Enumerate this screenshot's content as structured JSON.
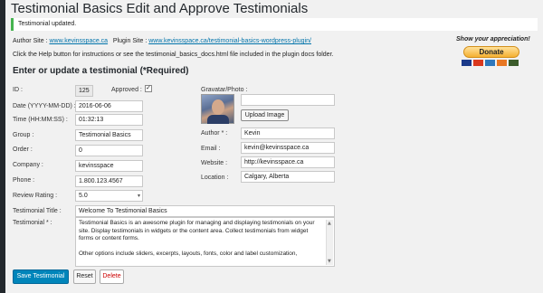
{
  "page": {
    "title": "Testimonial Basics Edit and Approve Testimonials",
    "notice": "Testimonial updated.",
    "author_site_label": "Author Site :",
    "author_site_link": "www.kevinsspace.ca",
    "plugin_site_label": "Plugin Site :",
    "plugin_site_link": "www.kevinsspace.ca/testimonial-basics-wordpress-plugin/",
    "help_text": "Click the Help button for instructions or see the testimonial_basics_docs.html file included in the plugin docs folder.",
    "appreciation": "Show your appreciation!",
    "donate_label": "Donate",
    "form_heading": "Enter or update a testimonial (*Required)"
  },
  "colors": {
    "accent": "#0073aa",
    "notice_border": "#46b450",
    "donate": "#f5b031",
    "delete": "#cc0000"
  },
  "form": {
    "id": {
      "label": "ID :",
      "value": "125"
    },
    "approved": {
      "label": "Approved :",
      "checked": true
    },
    "date": {
      "label": "Date (YYYY-MM-DD) :",
      "value": "2016-06-06"
    },
    "time": {
      "label": "Time (HH:MM:SS) :",
      "value": "01:32:13"
    },
    "group": {
      "label": "Group :",
      "value": "Testimonial Basics"
    },
    "order": {
      "label": "Order :",
      "value": "0"
    },
    "company": {
      "label": "Company :",
      "value": "kevinsspace"
    },
    "phone": {
      "label": "Phone :",
      "value": "1.800.123.4567"
    },
    "rating": {
      "label": "Review Rating :",
      "value": "5.0"
    },
    "testimonial_title": {
      "label": "Testimonial Title :",
      "value": "Welcome To Testimonial Basics"
    },
    "testimonial": {
      "label": "Testimonial * :",
      "para1": "Testimonial Basics is an awesome plugin for managing and displaying testimonials on your site. Display testimonials in widgets or the content area. Collect testimonials from widget forms or content forms.",
      "para2": "Other options include sliders, excerpts, layouts, fonts, color and label customization,"
    },
    "gravatar": {
      "label": "Gravatar/Photo :",
      "upload_label": "Upload Image"
    },
    "author": {
      "label": "Author * :",
      "value": "Kevin"
    },
    "email": {
      "label": "Email :",
      "value": "kevin@kevinsspace.ca"
    },
    "website": {
      "label": "Website :",
      "value": "http://kevinsspace.ca"
    },
    "location": {
      "label": "Location :",
      "value": "Calgary, Alberta"
    }
  },
  "actions": {
    "save": "Save Testimonial",
    "reset": "Reset",
    "delete": "Delete"
  },
  "cards": [
    "VISA",
    "MC",
    "AMEX",
    "DISC",
    "BANK"
  ]
}
